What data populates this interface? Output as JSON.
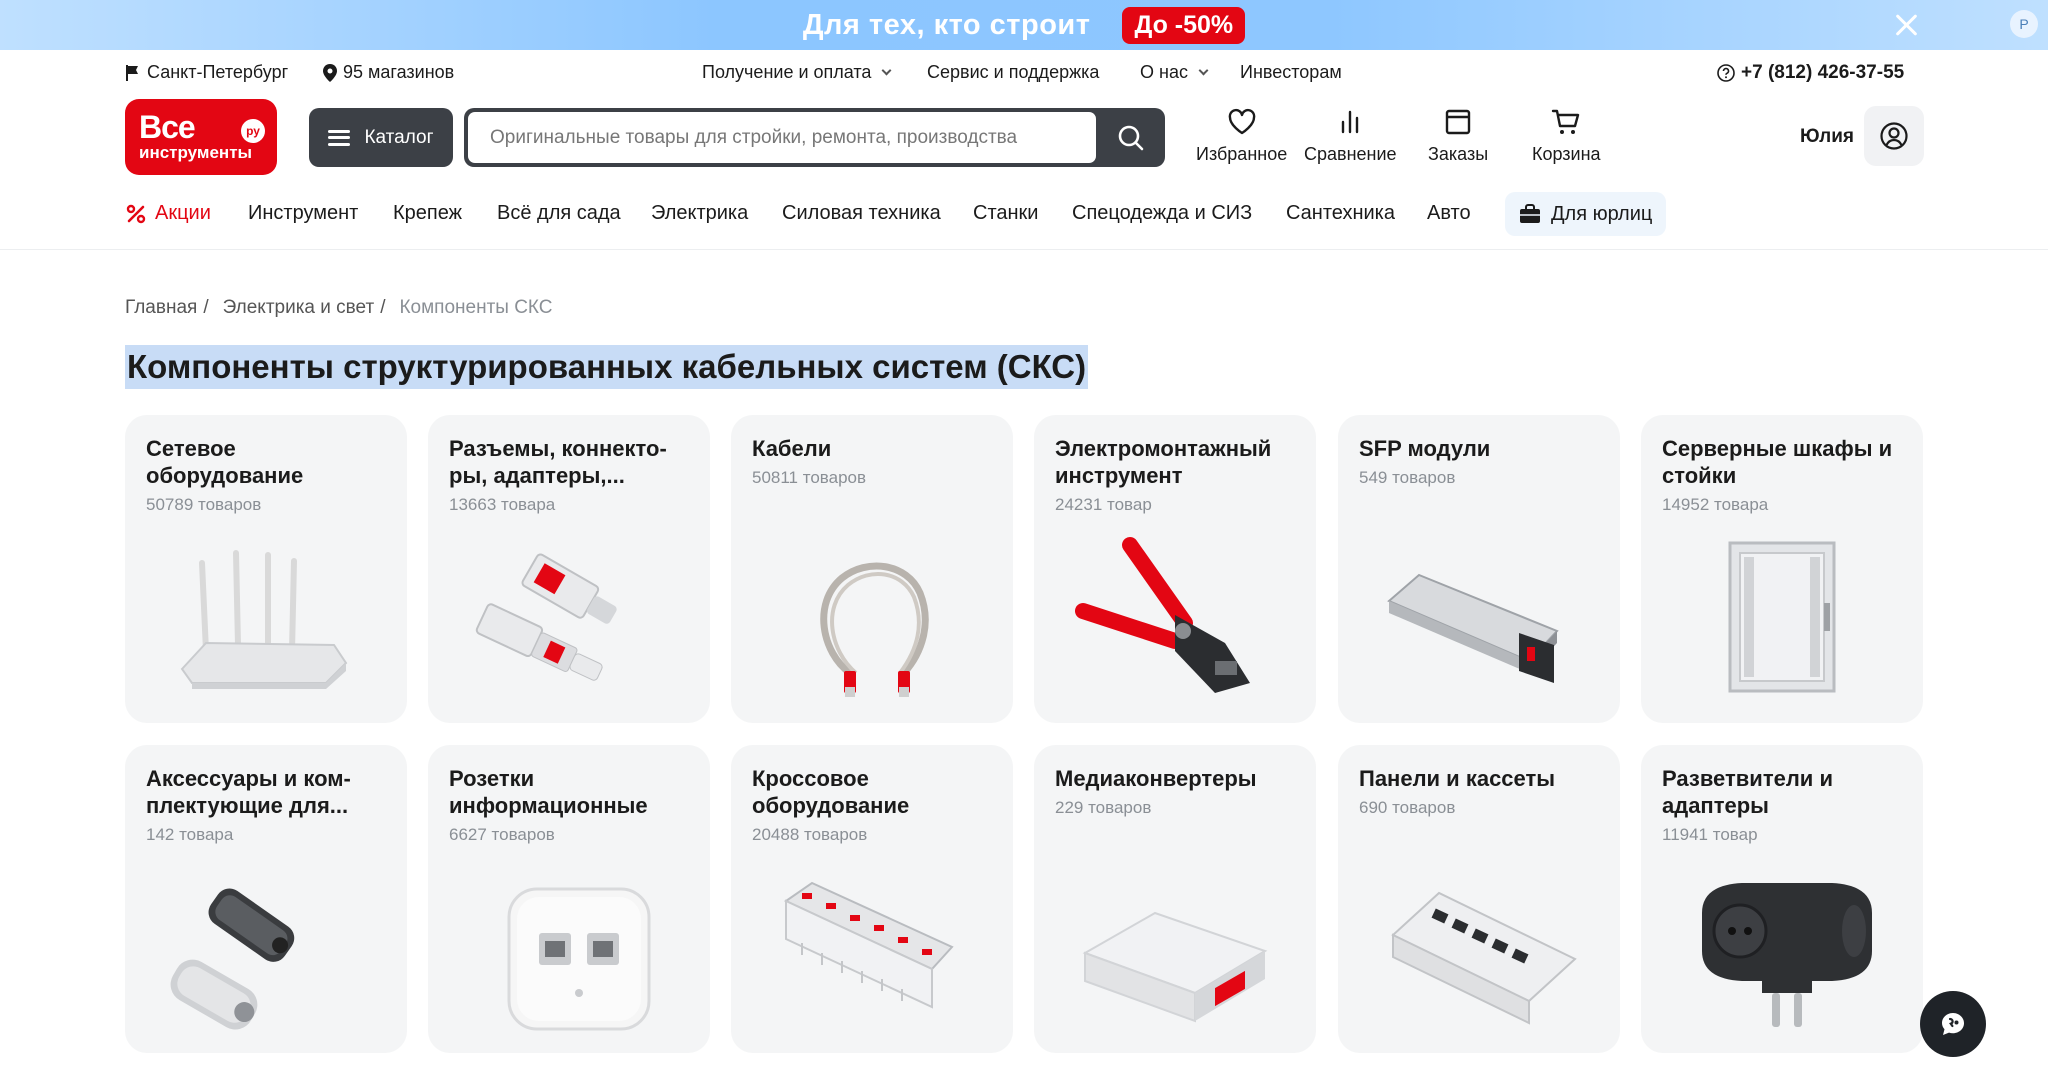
{
  "promo": {
    "text": "Для тех, кто строит",
    "badge": "До -50%",
    "corner_letter": "P"
  },
  "topbar": {
    "city": "Санкт-Петербург",
    "stores": "95 магазинов",
    "links": [
      "Получение и оплата",
      "Сервис и поддержка",
      "О нас",
      "Инвесторам"
    ],
    "phone": "+7 (812) 426-37-55"
  },
  "logo": {
    "line1": "Все",
    "line2": "инструменты",
    "ru": "ру"
  },
  "header": {
    "catalog_label": "Каталог",
    "search_placeholder": "Оригинальные товары для стройки, ремонта, производства",
    "favorites": "Избранное",
    "compare": "Сравнение",
    "orders": "Заказы",
    "cart": "Корзина",
    "user_name": "Юлия"
  },
  "nav": {
    "sale": "Акции",
    "items": [
      "Инструмент",
      "Крепеж",
      "Всё для сада",
      "Электрика",
      "Силовая техника",
      "Станки",
      "Спецодежда и СИЗ",
      "Сантехника",
      "Авто"
    ],
    "business": "Для юрлиц"
  },
  "breadcrumbs": {
    "home": "Главная",
    "parent": "Электрика и свет",
    "current": "Компоненты СКС",
    "sep": "/"
  },
  "page_title": "Компоненты структурированных кабельных систем (СКС)",
  "categories": [
    {
      "title": "Сетевое оборудование",
      "count": "50789 товаров",
      "icon": "router"
    },
    {
      "title": "Разъемы, коннекто-ры, адаптеры,...",
      "count": "13663 товара",
      "icon": "rj45-connectors"
    },
    {
      "title": "Кабели",
      "count": "50811 товаров",
      "icon": "patch-cable"
    },
    {
      "title": "Электромонтажный инструмент",
      "count": "24231 товар",
      "icon": "crimping-tool"
    },
    {
      "title": "SFP модули",
      "count": "549 товаров",
      "icon": "sfp-module"
    },
    {
      "title": "Серверные шкафы и стойки",
      "count": "14952 товара",
      "icon": "server-cabinet"
    },
    {
      "title": "Аксессуары и ком-плектующие для...",
      "count": "142 товара",
      "icon": "ferrite-cores"
    },
    {
      "title": "Розетки информационные",
      "count": "6627 товаров",
      "icon": "network-socket"
    },
    {
      "title": "Кроссовое оборудование",
      "count": "20488 товаров",
      "icon": "cross-module"
    },
    {
      "title": "Медиаконвертеры",
      "count": "229 товаров",
      "icon": "media-converter"
    },
    {
      "title": "Панели и кассеты",
      "count": "690 товаров",
      "icon": "patch-panel"
    },
    {
      "title": "Разветвители и адаптеры",
      "count": "11941 товар",
      "icon": "power-splitter"
    }
  ],
  "colors": {
    "brand_red": "#e30613",
    "dark": "#3c4046",
    "card_bg": "#f4f5f6",
    "highlight": "#c8dcf6"
  }
}
